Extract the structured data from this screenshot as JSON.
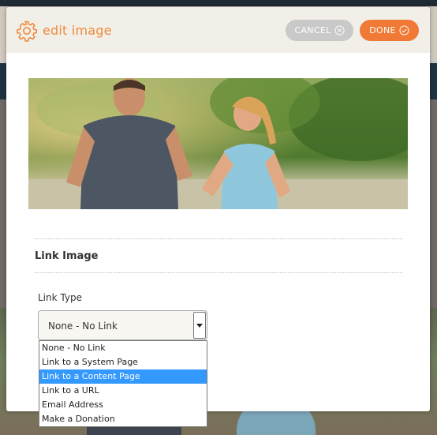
{
  "modal": {
    "title": "edit image",
    "cancel_label": "CANCEL",
    "done_label": "DONE"
  },
  "section": {
    "title": "Link Image"
  },
  "link_type": {
    "label": "Link Type",
    "selected": "None - No Link",
    "options": [
      "None - No Link",
      "Link to a System Page",
      "Link to a Content Page",
      "Link to a URL",
      "Email Address",
      "Make a Donation"
    ],
    "highlighted_index": 2
  },
  "colors": {
    "accent": "#f07a35",
    "highlight": "#3399ff"
  }
}
